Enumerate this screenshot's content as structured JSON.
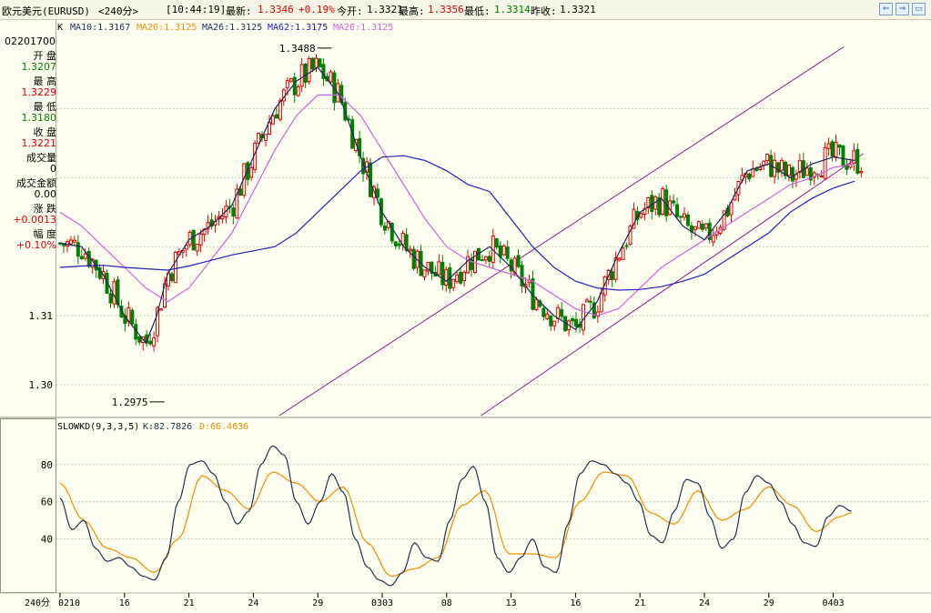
{
  "title_bar": {
    "symbol": "欧元美元(EURUSD)",
    "period": "<240分>",
    "time": "[10:44:19]",
    "latest_label": "最新:",
    "latest_value": "1.3346",
    "latest_change": "+0.19%",
    "open_label": "今开:",
    "open_value": "1.3321",
    "high_label": "最高:",
    "high_value": "1.3356",
    "low_label": "最低:",
    "low_value": "1.3314",
    "prev_label": "昨收:",
    "prev_value": "1.3321"
  },
  "window_buttons": [
    "⇐",
    "⇒",
    "▭"
  ],
  "info_panel": {
    "date": "02201700",
    "open_label": "开 盘",
    "open": "1.3207",
    "high_label": "最 高",
    "high": "1.3229",
    "low_label": "最 低",
    "low": "1.3180",
    "close_label": "收 盘",
    "close": "1.3221",
    "volume_label": "成交量",
    "volume": "0",
    "amount_label": "成交金额",
    "amount": "0.00",
    "change_label": "涨 跌",
    "change": "+0.0013",
    "range_label": "幅 度",
    "range": "+0.10%"
  },
  "ma_legend": {
    "k": "K",
    "ma10": "MA10:1.3167",
    "ma26a": "MA26:1.3125",
    "ma26b": "MA26:1.3125",
    "ma62": "MA62:1.3175",
    "ma26c": "MA26:1.3125"
  },
  "kd_legend": {
    "name": "SLOWKD(9,3,3,5)",
    "k": "K:82.7826",
    "d": "D:66.4636"
  },
  "period_label": "240分",
  "colors": {
    "up": "#E00000",
    "down": "#008000",
    "ma10": "#1A2A5A",
    "ma26": "#D060E0",
    "ma62": "#2020C0",
    "channel": "#8B1A8B",
    "kline": "#223355",
    "dline": "#F08C00",
    "grid": "#C8C8B0"
  },
  "chart_data": [
    {
      "type": "candlestick",
      "title": "",
      "y_ticks": [
        "1.31",
        "1.30"
      ],
      "ylim": [
        1.2955,
        1.3505
      ],
      "annotations": [
        {
          "text": "1.3488",
          "value": 1.3488,
          "day_index": 12.4
        },
        {
          "text": "1.2975",
          "value": 1.2975,
          "day_index": 4.6
        }
      ],
      "x_ticks": [
        {
          "label": "0210",
          "day_index": 0
        },
        {
          "label": "16",
          "day_index": 3
        },
        {
          "label": "21",
          "day_index": 6
        },
        {
          "label": "24",
          "day_index": 9
        },
        {
          "label": "29",
          "day_index": 12
        },
        {
          "label": "0303",
          "day_index": 15
        },
        {
          "label": "08",
          "day_index": 18
        },
        {
          "label": "13",
          "day_index": 21
        },
        {
          "label": "16",
          "day_index": 24
        },
        {
          "label": "21",
          "day_index": 27
        },
        {
          "label": "24",
          "day_index": 30
        },
        {
          "label": "29",
          "day_index": 33
        },
        {
          "label": "0403",
          "day_index": 36
        }
      ],
      "trend_channel": [
        {
          "from": [
            10.2,
            1.2955
          ],
          "to": [
            36.5,
            1.349
          ]
        },
        {
          "from": [
            19.6,
            1.2955
          ],
          "to": [
            37.4,
            1.3335
          ]
        }
      ],
      "ma_points": {
        "ma10": [
          [
            0,
            1.3205
          ],
          [
            1,
            1.32
          ],
          [
            2,
            1.316
          ],
          [
            3,
            1.31
          ],
          [
            4,
            1.306
          ],
          [
            4.5,
            1.31
          ],
          [
            5,
            1.316
          ],
          [
            6,
            1.321
          ],
          [
            7,
            1.323
          ],
          [
            8,
            1.326
          ],
          [
            9,
            1.333
          ],
          [
            10,
            1.34
          ],
          [
            11,
            1.344
          ],
          [
            12,
            1.346
          ],
          [
            13,
            1.342
          ],
          [
            14,
            1.333
          ],
          [
            15,
            1.325
          ],
          [
            16,
            1.32
          ],
          [
            17,
            1.317
          ],
          [
            18,
            1.315
          ],
          [
            19,
            1.318
          ],
          [
            20,
            1.32
          ],
          [
            21,
            1.317
          ],
          [
            22,
            1.313
          ],
          [
            23,
            1.31
          ],
          [
            24,
            1.308
          ],
          [
            25,
            1.312
          ],
          [
            26,
            1.319
          ],
          [
            27,
            1.325
          ],
          [
            28,
            1.327
          ],
          [
            29,
            1.323
          ],
          [
            30,
            1.321
          ],
          [
            31,
            1.325
          ],
          [
            32,
            1.331
          ],
          [
            33,
            1.332
          ],
          [
            34,
            1.33
          ],
          [
            35,
            1.332
          ],
          [
            36,
            1.333
          ],
          [
            37,
            1.3325
          ]
        ],
        "ma26": [
          [
            0,
            1.325
          ],
          [
            1,
            1.323
          ],
          [
            2,
            1.32
          ],
          [
            3,
            1.317
          ],
          [
            4,
            1.314
          ],
          [
            5,
            1.312
          ],
          [
            6,
            1.314
          ],
          [
            7,
            1.318
          ],
          [
            8,
            1.322
          ],
          [
            9,
            1.328
          ],
          [
            10,
            1.334
          ],
          [
            11,
            1.339
          ],
          [
            12,
            1.342
          ],
          [
            13,
            1.342
          ],
          [
            14,
            1.339
          ],
          [
            15,
            1.334
          ],
          [
            16,
            1.329
          ],
          [
            17,
            1.324
          ],
          [
            18,
            1.32
          ],
          [
            19,
            1.318
          ],
          [
            20,
            1.317
          ],
          [
            21,
            1.316
          ],
          [
            22,
            1.315
          ],
          [
            23,
            1.313
          ],
          [
            24,
            1.311
          ],
          [
            25,
            1.31
          ],
          [
            26,
            1.311
          ],
          [
            27,
            1.314
          ],
          [
            28,
            1.317
          ],
          [
            29,
            1.319
          ],
          [
            30,
            1.321
          ],
          [
            31,
            1.323
          ],
          [
            32,
            1.325
          ],
          [
            33,
            1.327
          ],
          [
            34,
            1.329
          ],
          [
            35,
            1.33
          ],
          [
            36,
            1.3315
          ],
          [
            37,
            1.332
          ]
        ],
        "ma62": [
          [
            0,
            1.317
          ],
          [
            1,
            1.3172
          ],
          [
            2,
            1.3173
          ],
          [
            3,
            1.317
          ],
          [
            4,
            1.3168
          ],
          [
            5,
            1.3166
          ],
          [
            6,
            1.3172
          ],
          [
            7,
            1.318
          ],
          [
            8,
            1.3188
          ],
          [
            9,
            1.3194
          ],
          [
            10,
            1.32
          ],
          [
            11,
            1.322
          ],
          [
            12,
            1.325
          ],
          [
            13,
            1.328
          ],
          [
            14,
            1.331
          ],
          [
            15,
            1.333
          ],
          [
            16,
            1.3332
          ],
          [
            17,
            1.3325
          ],
          [
            18,
            1.331
          ],
          [
            19,
            1.329
          ],
          [
            20,
            1.328
          ],
          [
            21,
            1.324
          ],
          [
            22,
            1.32
          ],
          [
            23,
            1.317
          ],
          [
            24,
            1.315
          ],
          [
            25,
            1.314
          ],
          [
            26,
            1.3137
          ],
          [
            27,
            1.3138
          ],
          [
            28,
            1.3142
          ],
          [
            29,
            1.315
          ],
          [
            30,
            1.316
          ],
          [
            31,
            1.318
          ],
          [
            32,
            1.32
          ],
          [
            33,
            1.322
          ],
          [
            34,
            1.325
          ],
          [
            35,
            1.327
          ],
          [
            36,
            1.3285
          ],
          [
            37,
            1.3295
          ]
        ]
      }
    },
    {
      "type": "line",
      "title": "",
      "y_ticks": [
        80,
        60,
        40
      ],
      "ylim": [
        12,
        96
      ],
      "series": [
        {
          "name": "K",
          "points": [
            [
              0,
              62
            ],
            [
              0.5,
              45
            ],
            [
              1,
              50
            ],
            [
              1.5,
              35
            ],
            [
              2,
              28
            ],
            [
              2.5,
              30
            ],
            [
              3,
              25
            ],
            [
              3.5,
              20
            ],
            [
              4,
              18
            ],
            [
              4.5,
              30
            ],
            [
              5,
              60
            ],
            [
              5.5,
              80
            ],
            [
              6,
              82
            ],
            [
              6.5,
              75
            ],
            [
              7,
              60
            ],
            [
              7.5,
              48
            ],
            [
              8,
              55
            ],
            [
              8.5,
              80
            ],
            [
              9,
              90
            ],
            [
              9.5,
              85
            ],
            [
              10,
              60
            ],
            [
              10.5,
              48
            ],
            [
              11,
              60
            ],
            [
              11.5,
              75
            ],
            [
              12,
              65
            ],
            [
              12.5,
              40
            ],
            [
              13,
              25
            ],
            [
              13.5,
              18
            ],
            [
              14,
              15
            ],
            [
              14.5,
              22
            ],
            [
              15,
              38
            ],
            [
              15.5,
              30
            ],
            [
              16,
              28
            ],
            [
              16.5,
              50
            ],
            [
              17,
              72
            ],
            [
              17.5,
              79
            ],
            [
              18,
              60
            ],
            [
              18.5,
              30
            ],
            [
              19,
              22
            ],
            [
              19.5,
              30
            ],
            [
              20,
              40
            ],
            [
              20.5,
              25
            ],
            [
              21,
              22
            ],
            [
              21.5,
              48
            ],
            [
              22,
              75
            ],
            [
              22.5,
              82
            ],
            [
              23,
              80
            ],
            [
              23.5,
              75
            ],
            [
              24,
              70
            ],
            [
              24.5,
              60
            ],
            [
              25,
              42
            ],
            [
              25.5,
              38
            ],
            [
              26,
              55
            ],
            [
              26.5,
              72
            ],
            [
              27,
              70
            ],
            [
              27.5,
              52
            ],
            [
              28,
              35
            ],
            [
              28.5,
              40
            ],
            [
              29,
              65
            ],
            [
              29.5,
              74
            ],
            [
              30,
              70
            ],
            [
              30.5,
              60
            ],
            [
              31,
              48
            ],
            [
              31.5,
              38
            ],
            [
              32,
              36
            ],
            [
              32.5,
              52
            ],
            [
              33,
              58
            ],
            [
              33.5,
              55
            ]
          ]
        },
        {
          "name": "D",
          "points": [
            [
              0,
              70
            ],
            [
              1,
              50
            ],
            [
              2,
              35
            ],
            [
              3,
              30
            ],
            [
              4,
              22
            ],
            [
              5,
              40
            ],
            [
              6,
              74
            ],
            [
              7,
              66
            ],
            [
              8,
              56
            ],
            [
              9,
              76
            ],
            [
              10,
              70
            ],
            [
              11,
              60
            ],
            [
              12,
              68
            ],
            [
              13,
              38
            ],
            [
              14,
              20
            ],
            [
              15,
              24
            ],
            [
              16,
              30
            ],
            [
              17,
              58
            ],
            [
              18,
              66
            ],
            [
              19,
              32
            ],
            [
              20,
              32
            ],
            [
              21,
              30
            ],
            [
              22,
              60
            ],
            [
              23,
              76
            ],
            [
              24,
              74
            ],
            [
              25,
              54
            ],
            [
              26,
              48
            ],
            [
              27,
              66
            ],
            [
              28,
              50
            ],
            [
              29,
              56
            ],
            [
              30,
              68
            ],
            [
              31,
              58
            ],
            [
              32,
              44
            ],
            [
              33,
              52
            ],
            [
              33.5,
              54
            ]
          ]
        }
      ],
      "days_extent": [
        0,
        37.5
      ]
    }
  ]
}
